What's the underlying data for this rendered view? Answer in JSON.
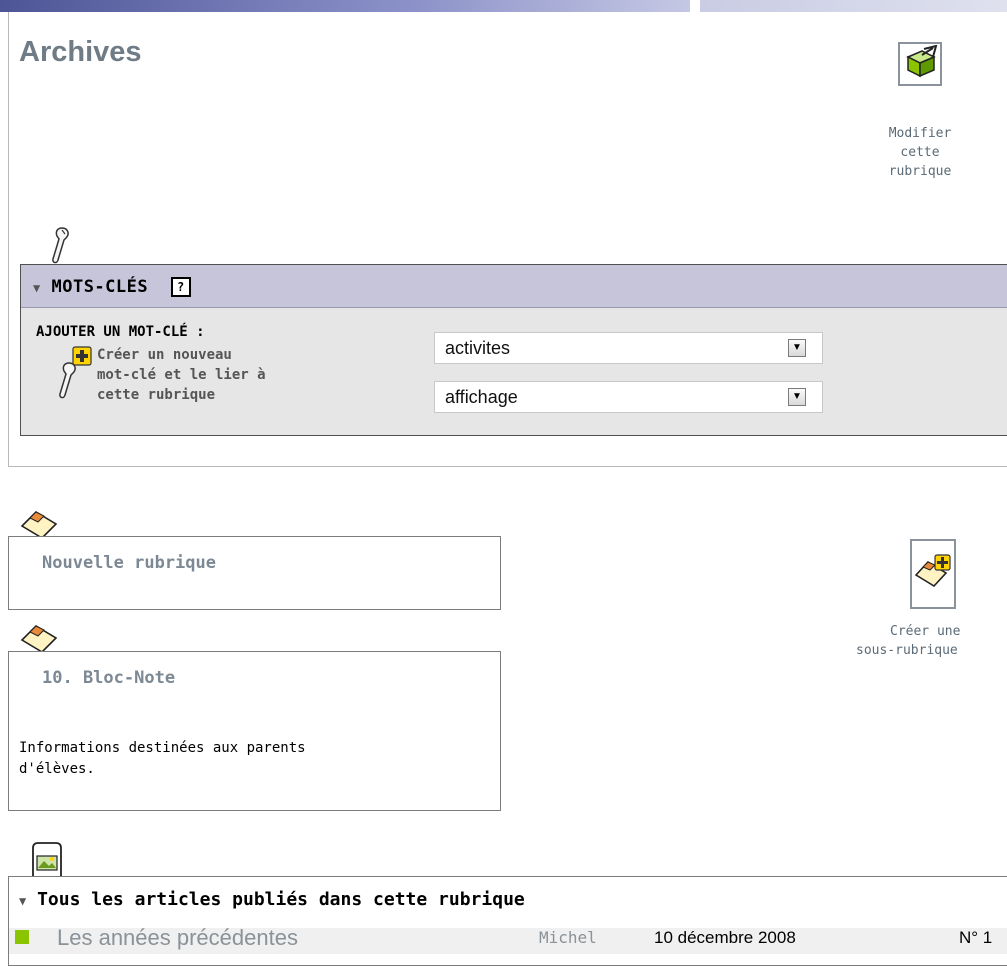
{
  "page": {
    "title": "Archives"
  },
  "edit_action": {
    "label_lines": [
      "Modifier",
      "cette",
      "rubrique"
    ]
  },
  "keywords": {
    "title": "MOTS-CLÉS",
    "help": "?",
    "add_label": "AJOUTER UN MOT-CLÉ :",
    "create_lines": [
      "Créer un nouveau",
      "mot-clé et le lier à",
      "cette rubrique"
    ],
    "selects": [
      {
        "value": "activites"
      },
      {
        "value": "affichage"
      }
    ]
  },
  "subsections": [
    {
      "title": "Nouvelle rubrique",
      "description": ""
    },
    {
      "title": "10. Bloc-Note",
      "description_lines": [
        "Informations destinées aux parents",
        "d'élèves."
      ]
    }
  ],
  "create_sub_action": {
    "label_lines": [
      "Créer une",
      "sous-rubrique"
    ]
  },
  "articles": {
    "title": "Tous les articles publiés dans cette rubrique",
    "rows": [
      {
        "title": "Les années précédentes",
        "author": "Michel",
        "date": "10 décembre 2008",
        "number": "N° 1"
      }
    ]
  },
  "colors": {
    "accent_title": "#6f7b85",
    "keyword_header": "#c7c5d9",
    "keyword_panel": "#e6e6e6",
    "bullet_green": "#8bc400"
  }
}
